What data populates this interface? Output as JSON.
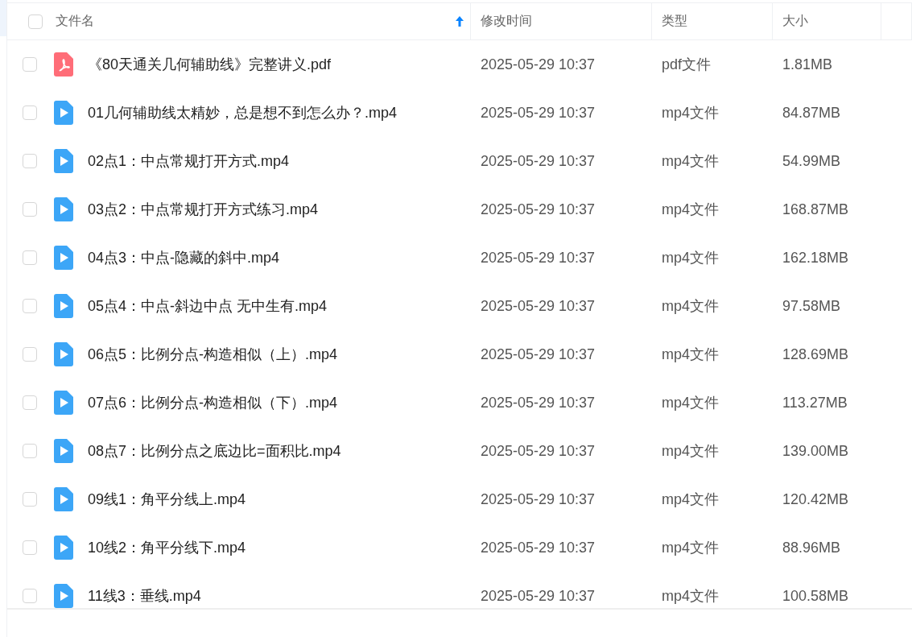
{
  "header": {
    "checked": false,
    "columns": [
      {
        "label": "文件名",
        "sorted": true
      },
      {
        "label": "修改时间",
        "sorted": false
      },
      {
        "label": "类型",
        "sorted": false
      },
      {
        "label": "大小",
        "sorted": false
      }
    ]
  },
  "rows": [
    {
      "kind": "pdf",
      "checked": false,
      "name": "《80天通关几何辅助线》完整讲义.pdf",
      "modified": "2025-05-29 10:37",
      "type": "pdf文件",
      "size": "1.81MB"
    },
    {
      "kind": "video",
      "checked": false,
      "name": "01几何辅助线太精妙，总是想不到怎么办？.mp4",
      "modified": "2025-05-29 10:37",
      "type": "mp4文件",
      "size": "84.87MB"
    },
    {
      "kind": "video",
      "checked": false,
      "name": "02点1：中点常规打开方式.mp4",
      "modified": "2025-05-29 10:37",
      "type": "mp4文件",
      "size": "54.99MB"
    },
    {
      "kind": "video",
      "checked": false,
      "name": "03点2：中点常规打开方式练习.mp4",
      "modified": "2025-05-29 10:37",
      "type": "mp4文件",
      "size": "168.87MB"
    },
    {
      "kind": "video",
      "checked": false,
      "name": "04点3：中点-隐藏的斜中.mp4",
      "modified": "2025-05-29 10:37",
      "type": "mp4文件",
      "size": "162.18MB"
    },
    {
      "kind": "video",
      "checked": false,
      "name": "05点4：中点-斜边中点 无中生有.mp4",
      "modified": "2025-05-29 10:37",
      "type": "mp4文件",
      "size": "97.58MB"
    },
    {
      "kind": "video",
      "checked": false,
      "name": "06点5：比例分点-构造相似（上）.mp4",
      "modified": "2025-05-29 10:37",
      "type": "mp4文件",
      "size": "128.69MB"
    },
    {
      "kind": "video",
      "checked": false,
      "name": "07点6：比例分点-构造相似（下）.mp4",
      "modified": "2025-05-29 10:37",
      "type": "mp4文件",
      "size": "113.27MB"
    },
    {
      "kind": "video",
      "checked": false,
      "name": "08点7：比例分点之底边比=面积比.mp4",
      "modified": "2025-05-29 10:37",
      "type": "mp4文件",
      "size": "139.00MB"
    },
    {
      "kind": "video",
      "checked": false,
      "name": "09线1：角平分线上.mp4",
      "modified": "2025-05-29 10:37",
      "type": "mp4文件",
      "size": "120.42MB"
    },
    {
      "kind": "video",
      "checked": false,
      "name": "10线2：角平分线下.mp4",
      "modified": "2025-05-29 10:37",
      "type": "mp4文件",
      "size": "88.96MB"
    },
    {
      "kind": "video",
      "checked": false,
      "name": "11线3：垂线.mp4",
      "modified": "2025-05-29 10:37",
      "type": "mp4文件",
      "size": "100.58MB"
    }
  ]
}
